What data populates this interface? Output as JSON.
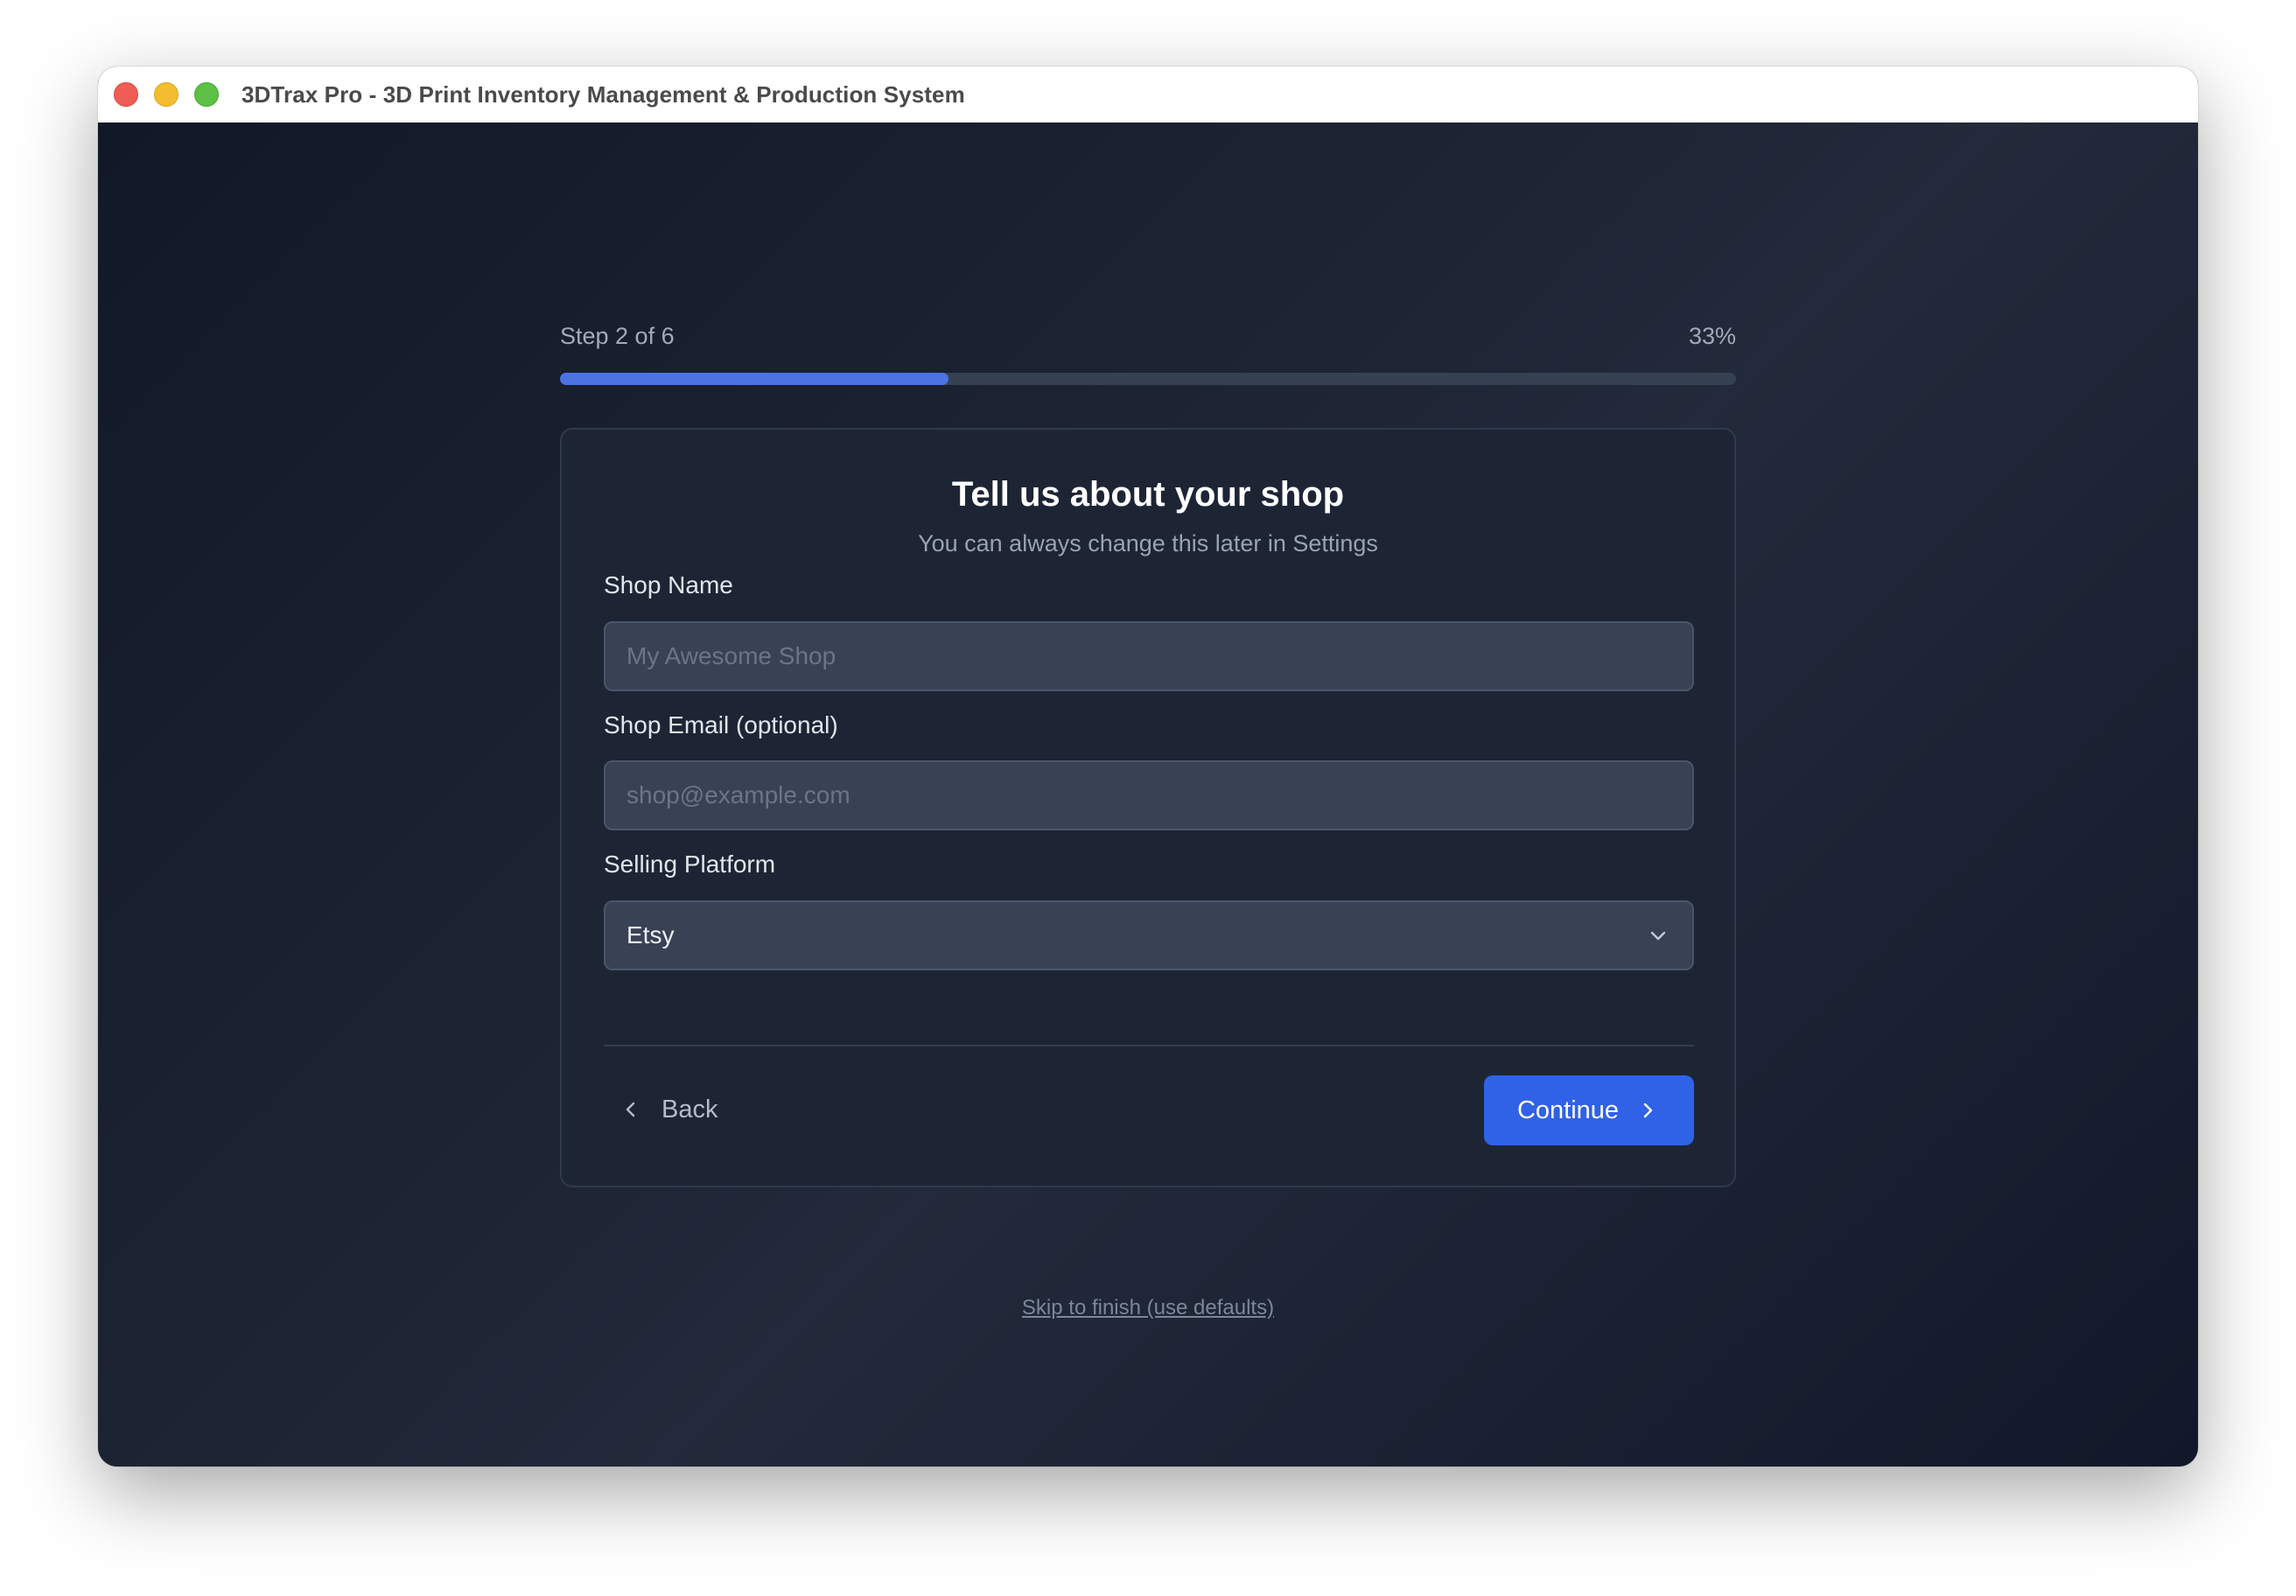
{
  "window": {
    "title": "3DTrax Pro - 3D Print Inventory Management & Production System",
    "controls": [
      "close",
      "minimize",
      "zoom"
    ]
  },
  "progress": {
    "step_label": "Step 2 of 6",
    "percent_label": "33%",
    "percent": 33
  },
  "card": {
    "title": "Tell us about your shop",
    "subtitle": "You can always change this later in Settings",
    "fields": {
      "shop_name": {
        "label": "Shop Name",
        "value": "",
        "placeholder": "My Awesome Shop"
      },
      "shop_email": {
        "label": "Shop Email (optional)",
        "value": "",
        "placeholder": "shop@example.com"
      },
      "platform": {
        "label": "Selling Platform",
        "selected": "Etsy",
        "icon": "chevron-down-icon"
      }
    },
    "back": {
      "label": "Back",
      "icon": "chevron-left-icon"
    },
    "continue": {
      "label": "Continue",
      "icon": "chevron-right-icon"
    }
  },
  "skip": {
    "label": "Skip to finish (use defaults)"
  },
  "colors": {
    "accent": "#2f62e6",
    "progress_fill": "#4b74e2",
    "card_bg": "#1d2535"
  }
}
